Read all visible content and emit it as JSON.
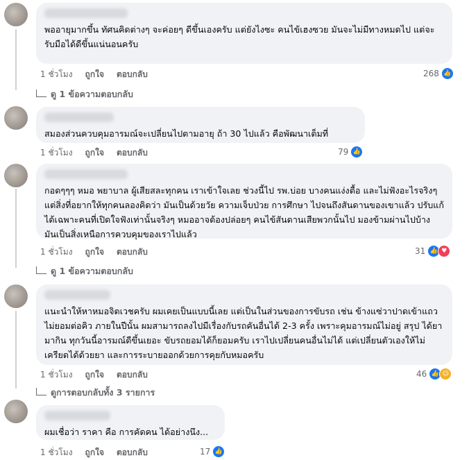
{
  "comments": [
    {
      "text": "พออายุมากขึ้น ทัศนคิดต่างๆ จะค่อยๆ ดีขึ้นเองครับ แต่ยังไงซะ คนไข้เฮงซวย มันจะไม่มีทางหมดไป แต่จะรับมือได้ดีขึ้นแน่นอนครับ",
      "time": "1 ชั่วโมง",
      "like": "ถูกใจ",
      "reply": "ตอบกลับ",
      "reactions": "268",
      "replies_label": "ดู 1 ข้อความตอบกลับ"
    },
    {
      "text": "สมองส่วนควบคุมอารมณ์จะเปลี่ยนไปตามอายุ ถ้า 30 ไปแล้ว คือพัฒนาเต็มที่",
      "time": "1 ชั่วโมง",
      "like": "ถูกใจ",
      "reply": "ตอบกลับ",
      "reactions": "79"
    },
    {
      "text": "กอดๆๆๆ หมอ พยาบาล ผู้เสียสละทุกคน เราเข้าใจเลย ช่วงนี้ไป รพ.บ่อย บางคนแง่งตื้อ และไม่ฟังอะไรจริงๆ แต่สิ่งที่อยากให้ทุกคนลองคิดว่า มันเป็นด้วยวัย ความเจ็บป่วย การศึกษา ไปจนถึงสันดานของเขาแล้ว ปรับแก้ได้เฉพาะคนที่เปิดใจฟังเท่านั้นจริงๆ หมออาจต้องปล่อยๆ คนไข้สันดานเสียพวกนั้นไป มองข้ามผ่านไปบ้าง มันเป็นสิ่งเหนือการควบคุมของเราไปแล้ว",
      "time": "1 ชั่วโมง",
      "like": "ถูกใจ",
      "reply": "ตอบกลับ",
      "reactions": "31",
      "replies_label": "ดู 1 ข้อความตอบกลับ"
    },
    {
      "text": "แนะนำให้หาหมอจิตเวชครับ ผมเคยเป็นแบบนี้เลย แต่เป็นในส่วนของการขับรถ เช่น ข้างแซ่วาปาดเข้าแถว ไม่ยอมต่อคิว ภายในปีนั้น ผมสามารถลงไปมีเรื่องกับรถคันอื่นได้ 2-3 ครั้ง เพราะคุมอารมณ์ไม่อยู่ สรุป ได้ยามากิน ทุกวันนี้อารมณ์ดีขึ้นเยอะ ขับรถยอมได้ก็ยอมครับ เราไปเปลี่ยนคนอื่นไม่ได้ แต่เปลี่ยนตัวเองให้ไม่เครียดได้ด้วยยา และการระบายออกด้วยการคุยกับหมอครับ",
      "time": "1 ชั่วโมง",
      "like": "ถูกใจ",
      "reply": "ตอบกลับ",
      "reactions": "46",
      "replies_label": "ดูการตอบกลับทั้ง 3 รายการ"
    },
    {
      "text": "ผมเชื่อว่า ราคา คือ การคัดคน ได้อย่างนึง...",
      "time": "1 ชั่วโมง",
      "like": "ถูกใจ",
      "reply": "ตอบกลับ",
      "reactions": "17"
    }
  ],
  "colors": {
    "like": "#1877f2",
    "love": "#f33e58",
    "care": "#f7b125",
    "bubble": "#f0f2f5",
    "meta": "#65676b"
  }
}
